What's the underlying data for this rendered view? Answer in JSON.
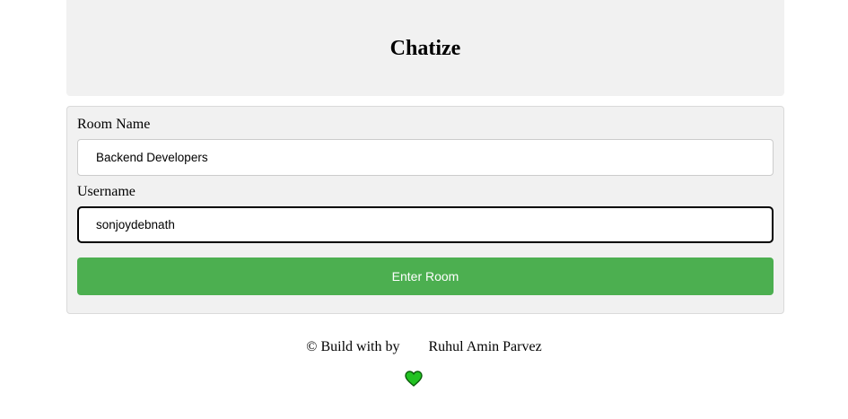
{
  "header": {
    "title": "Chatize"
  },
  "form": {
    "room_label": "Room Name",
    "room_value": "Backend Developers",
    "username_label": "Username",
    "username_value": "sonjoydebnath",
    "submit_label": "Enter Room"
  },
  "footer": {
    "prefix": "© Build with by",
    "icon": "heart-icon",
    "author": "Ruhul Amin Parvez"
  },
  "colors": {
    "accent": "#4caf50",
    "heart": "#22c222",
    "panel": "#f1f1f1"
  }
}
